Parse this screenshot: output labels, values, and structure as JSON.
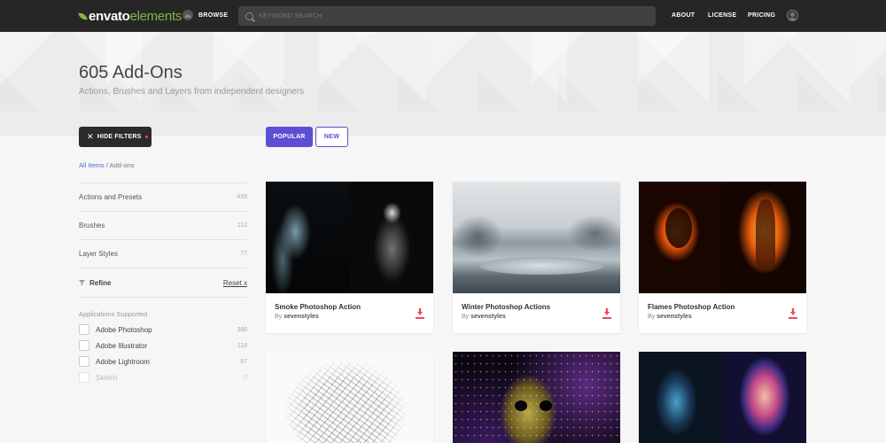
{
  "nav": {
    "logo_main": "envato",
    "logo_sub": "elements",
    "browse": "BROWSE",
    "search_placeholder": "KEYWORD SEARCH",
    "links": [
      "ABOUT",
      "LICENSE",
      "PRICING"
    ]
  },
  "hero": {
    "title": "605 Add-Ons",
    "subtitle": "Actions, Brushes and Layers from independent designers"
  },
  "filters": {
    "hide_label": "HIDE FILTERS",
    "breadcrumb_link": "All Items",
    "breadcrumb_sep": " / ",
    "breadcrumb_current": "Add-ons",
    "categories": [
      {
        "label": "Actions and Presets",
        "count": "433"
      },
      {
        "label": "Brushes",
        "count": "112"
      },
      {
        "label": "Layer Styles",
        "count": "77"
      }
    ],
    "refine_label": "Refine",
    "reset_label": "Reset x",
    "apps_title": "Applications Supported",
    "apps": [
      {
        "label": "Adobe Photoshop",
        "count": "386",
        "disabled": false
      },
      {
        "label": "Adobe Illustrator",
        "count": "118",
        "disabled": false
      },
      {
        "label": "Adobe Lightroom",
        "count": "97",
        "disabled": false
      },
      {
        "label": "Sketch",
        "count": "0",
        "disabled": true
      }
    ]
  },
  "sort": {
    "popular": "POPULAR",
    "new": "NEW",
    "active": "popular"
  },
  "cards": [
    {
      "title": "Smoke Photoshop Action",
      "by_prefix": "By ",
      "author": "sevenstyles"
    },
    {
      "title": "Winter Photoshop Actions",
      "by_prefix": "By ",
      "author": "sevenstyles"
    },
    {
      "title": "Flames Photoshop Action",
      "by_prefix": "By ",
      "author": "sevenstyles"
    }
  ],
  "colors": {
    "accent": "#5c4fd3",
    "download": "#e84a5f",
    "brand_green": "#82b541",
    "nav_bg": "#262626"
  }
}
